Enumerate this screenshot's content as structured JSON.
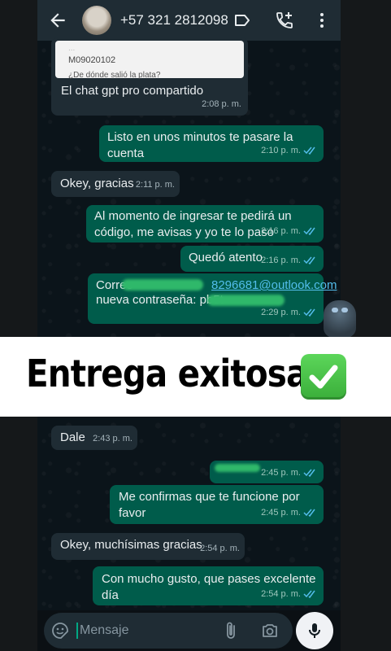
{
  "header": {
    "contact_phone": "+57 321 2812098"
  },
  "quoted_card": {
    "line1": "...",
    "code": "M09020102",
    "question": "¿De dónde salió la plata?"
  },
  "messages": [
    {
      "dir": "in",
      "text": "El chat gpt pro compartido",
      "time": "2:08 p. m."
    },
    {
      "dir": "out",
      "text": "Listo en unos minutos te pasare la cuenta",
      "time": "2:10 p. m."
    },
    {
      "dir": "in",
      "text": "Okey, gracias",
      "time": "2:11 p. m."
    },
    {
      "dir": "out",
      "text": "Al momento de ingresar te pedirá un código, me avisas y yo te lo paso",
      "time": "2:16 p. m."
    },
    {
      "dir": "out",
      "text": "Quedó atento",
      "time": "2:16 p. m."
    },
    {
      "dir": "out",
      "line1": "Correo",
      "line1_tail": "8296681@outlook.com",
      "line2": "nueva contraseña:  pb5t",
      "time": "2:29 p. m."
    },
    {
      "dir": "in",
      "text": "Dale",
      "time": "2:43 p. m."
    },
    {
      "dir": "out",
      "text": "",
      "time": "2:45 p. m."
    },
    {
      "dir": "out",
      "text": "Me confirmas que te funcione por favor",
      "time": "2:45 p. m."
    },
    {
      "dir": "in",
      "text": "Okey, muchísimas gracias",
      "time": "2:54 p. m."
    },
    {
      "dir": "out",
      "text": "Con mucho gusto, que pases excelente día",
      "time": "2:54 p. m."
    }
  ],
  "banner": {
    "text": "Entrega exitosa"
  },
  "input": {
    "placeholder": "Mensaje"
  },
  "colors": {
    "outgoing_bubble": "#005c4b",
    "incoming_bubble": "#1f2c34",
    "read_ticks": "#53bdeb",
    "banner_check": "#4cc64a"
  }
}
